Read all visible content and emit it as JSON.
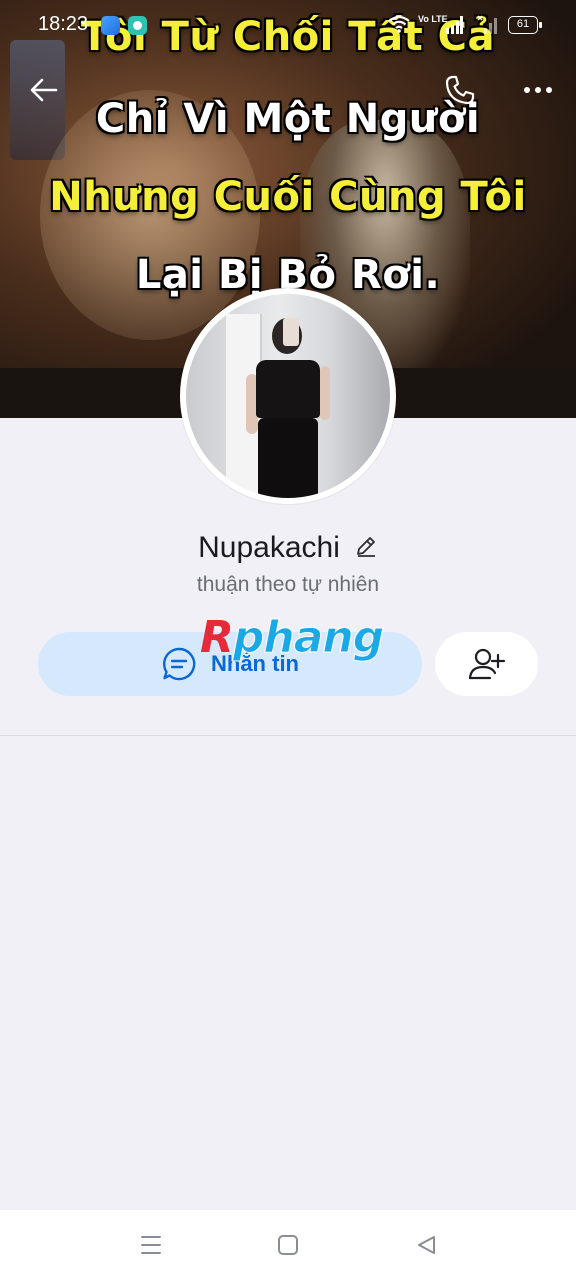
{
  "status_bar": {
    "time": "18:23",
    "network_label": "Vo LTE",
    "battery": "61"
  },
  "cover": {
    "lines": [
      {
        "text": "Tôi Từ Chối Tất Cả",
        "color": "#f6ef3a"
      },
      {
        "text": "Chỉ Vì Một Người",
        "color": "#ffffff"
      },
      {
        "text": "Nhưng Cuối Cùng Tôi",
        "color": "#f6ef3a"
      },
      {
        "text": "Lại Bị Bỏ Rơi.",
        "color": "#ffffff"
      }
    ]
  },
  "header": {
    "back_icon": "arrow-left-icon",
    "call_icon": "phone-icon",
    "more_icon": "more-dots-icon"
  },
  "profile": {
    "name": "Nupakachi",
    "bio": "thuận theo tự nhiên"
  },
  "actions": {
    "message_label": "Nhắn tin",
    "add_friend_icon": "add-friend-icon"
  },
  "watermark": {
    "first": "R",
    "rest": "phang"
  },
  "colors": {
    "accent": "#0a68d6",
    "message_button_bg": "#d6e9fc",
    "page_bg": "#f0f0f6"
  }
}
